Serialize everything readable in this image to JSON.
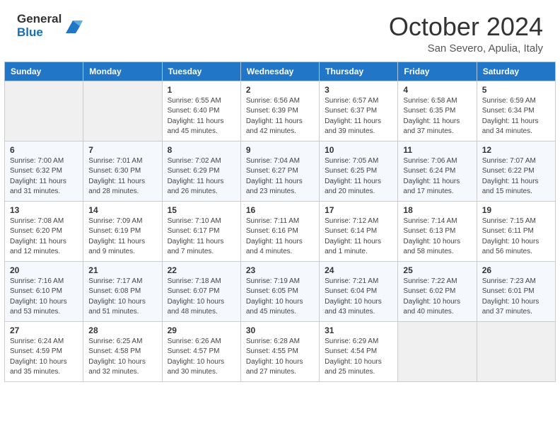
{
  "header": {
    "logo_general": "General",
    "logo_blue": "Blue",
    "month_year": "October 2024",
    "location": "San Severo, Apulia, Italy"
  },
  "days_of_week": [
    "Sunday",
    "Monday",
    "Tuesday",
    "Wednesday",
    "Thursday",
    "Friday",
    "Saturday"
  ],
  "weeks": [
    [
      {
        "num": "",
        "empty": true
      },
      {
        "num": "",
        "empty": true
      },
      {
        "num": "1",
        "sunrise": "6:55 AM",
        "sunset": "6:40 PM",
        "daylight": "11 hours and 45 minutes."
      },
      {
        "num": "2",
        "sunrise": "6:56 AM",
        "sunset": "6:39 PM",
        "daylight": "11 hours and 42 minutes."
      },
      {
        "num": "3",
        "sunrise": "6:57 AM",
        "sunset": "6:37 PM",
        "daylight": "11 hours and 39 minutes."
      },
      {
        "num": "4",
        "sunrise": "6:58 AM",
        "sunset": "6:35 PM",
        "daylight": "11 hours and 37 minutes."
      },
      {
        "num": "5",
        "sunrise": "6:59 AM",
        "sunset": "6:34 PM",
        "daylight": "11 hours and 34 minutes."
      }
    ],
    [
      {
        "num": "6",
        "sunrise": "7:00 AM",
        "sunset": "6:32 PM",
        "daylight": "11 hours and 31 minutes."
      },
      {
        "num": "7",
        "sunrise": "7:01 AM",
        "sunset": "6:30 PM",
        "daylight": "11 hours and 28 minutes."
      },
      {
        "num": "8",
        "sunrise": "7:02 AM",
        "sunset": "6:29 PM",
        "daylight": "11 hours and 26 minutes."
      },
      {
        "num": "9",
        "sunrise": "7:04 AM",
        "sunset": "6:27 PM",
        "daylight": "11 hours and 23 minutes."
      },
      {
        "num": "10",
        "sunrise": "7:05 AM",
        "sunset": "6:25 PM",
        "daylight": "11 hours and 20 minutes."
      },
      {
        "num": "11",
        "sunrise": "7:06 AM",
        "sunset": "6:24 PM",
        "daylight": "11 hours and 17 minutes."
      },
      {
        "num": "12",
        "sunrise": "7:07 AM",
        "sunset": "6:22 PM",
        "daylight": "11 hours and 15 minutes."
      }
    ],
    [
      {
        "num": "13",
        "sunrise": "7:08 AM",
        "sunset": "6:20 PM",
        "daylight": "11 hours and 12 minutes."
      },
      {
        "num": "14",
        "sunrise": "7:09 AM",
        "sunset": "6:19 PM",
        "daylight": "11 hours and 9 minutes."
      },
      {
        "num": "15",
        "sunrise": "7:10 AM",
        "sunset": "6:17 PM",
        "daylight": "11 hours and 7 minutes."
      },
      {
        "num": "16",
        "sunrise": "7:11 AM",
        "sunset": "6:16 PM",
        "daylight": "11 hours and 4 minutes."
      },
      {
        "num": "17",
        "sunrise": "7:12 AM",
        "sunset": "6:14 PM",
        "daylight": "11 hours and 1 minute."
      },
      {
        "num": "18",
        "sunrise": "7:14 AM",
        "sunset": "6:13 PM",
        "daylight": "10 hours and 58 minutes."
      },
      {
        "num": "19",
        "sunrise": "7:15 AM",
        "sunset": "6:11 PM",
        "daylight": "10 hours and 56 minutes."
      }
    ],
    [
      {
        "num": "20",
        "sunrise": "7:16 AM",
        "sunset": "6:10 PM",
        "daylight": "10 hours and 53 minutes."
      },
      {
        "num": "21",
        "sunrise": "7:17 AM",
        "sunset": "6:08 PM",
        "daylight": "10 hours and 51 minutes."
      },
      {
        "num": "22",
        "sunrise": "7:18 AM",
        "sunset": "6:07 PM",
        "daylight": "10 hours and 48 minutes."
      },
      {
        "num": "23",
        "sunrise": "7:19 AM",
        "sunset": "6:05 PM",
        "daylight": "10 hours and 45 minutes."
      },
      {
        "num": "24",
        "sunrise": "7:21 AM",
        "sunset": "6:04 PM",
        "daylight": "10 hours and 43 minutes."
      },
      {
        "num": "25",
        "sunrise": "7:22 AM",
        "sunset": "6:02 PM",
        "daylight": "10 hours and 40 minutes."
      },
      {
        "num": "26",
        "sunrise": "7:23 AM",
        "sunset": "6:01 PM",
        "daylight": "10 hours and 37 minutes."
      }
    ],
    [
      {
        "num": "27",
        "sunrise": "6:24 AM",
        "sunset": "4:59 PM",
        "daylight": "10 hours and 35 minutes."
      },
      {
        "num": "28",
        "sunrise": "6:25 AM",
        "sunset": "4:58 PM",
        "daylight": "10 hours and 32 minutes."
      },
      {
        "num": "29",
        "sunrise": "6:26 AM",
        "sunset": "4:57 PM",
        "daylight": "10 hours and 30 minutes."
      },
      {
        "num": "30",
        "sunrise": "6:28 AM",
        "sunset": "4:55 PM",
        "daylight": "10 hours and 27 minutes."
      },
      {
        "num": "31",
        "sunrise": "6:29 AM",
        "sunset": "4:54 PM",
        "daylight": "10 hours and 25 minutes."
      },
      {
        "num": "",
        "empty": true
      },
      {
        "num": "",
        "empty": true
      }
    ]
  ],
  "labels": {
    "sunrise": "Sunrise:",
    "sunset": "Sunset:",
    "daylight": "Daylight:"
  }
}
